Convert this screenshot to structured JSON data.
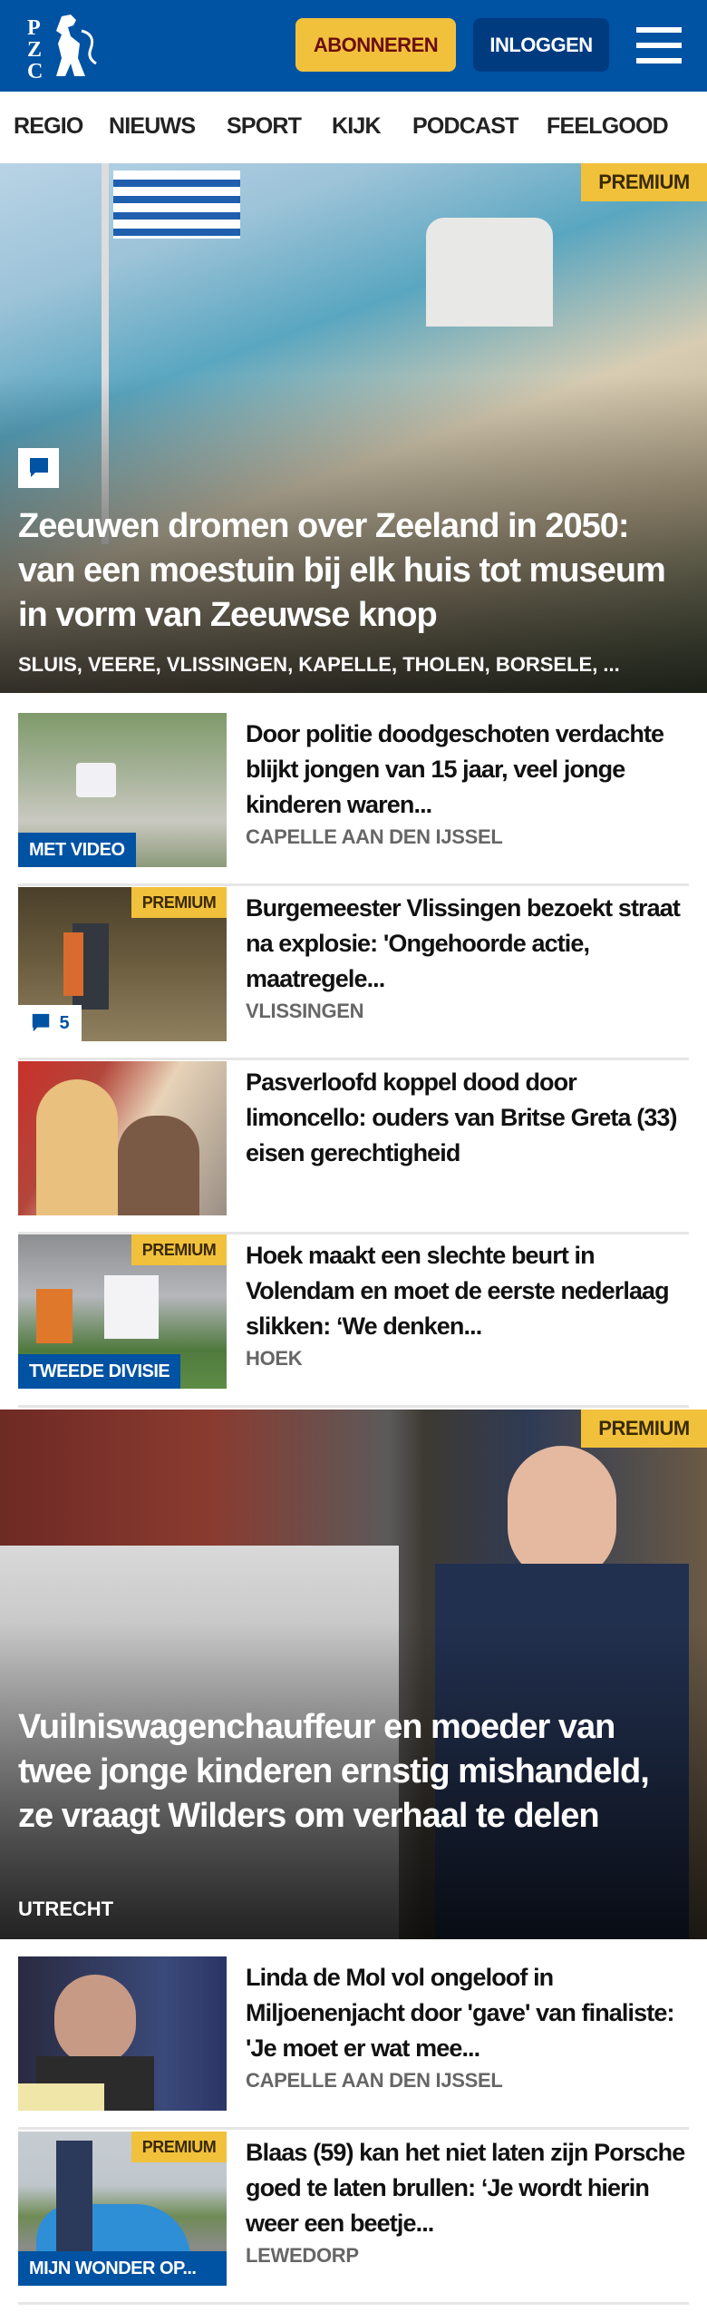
{
  "header": {
    "logo_text": "PZC",
    "subscribe_label": "ABONNEREN",
    "login_label": "INLOGGEN",
    "menu_icon": "hamburger-icon"
  },
  "nav": [
    "REGIO",
    "NIEUWS",
    "SPORT",
    "KIJK",
    "PODCAST",
    "FEELGOOD"
  ],
  "colors": {
    "brand": "#0052a3",
    "premium": "#f2c13c",
    "subscribe_text": "#6b0e0e",
    "login_bg": "#003b80"
  },
  "hero1": {
    "badge": "PREMIUM",
    "headline": "Zeeuwen dromen over Zeeland in 2050: van een moestuin bij elk huis tot museum in vorm van Zeeuwse knop",
    "tags": "SLUIS, VEERE, VLISSINGEN, KAPELLE, THOLEN, BORSELE, ..."
  },
  "list1": [
    {
      "headline": "Door politie doodgeschoten verdachte blijkt jongen van 15 jaar, veel jonge kinderen waren...",
      "location": "CAPELLE AAN DEN IJSSEL",
      "label": "MET VIDEO"
    },
    {
      "headline": "Burgemeester Vlissingen bezoekt straat na explosie: 'Ongehoorde actie, maatregele...",
      "location": "VLISSINGEN",
      "badge": "PREMIUM",
      "comments": "5"
    },
    {
      "headline": "Pasverloofd koppel dood door limoncello: ouders van Britse Greta (33) eisen gerechtigheid"
    },
    {
      "headline": "Hoek maakt een slechte beurt in Volendam en moet de eerste nederlaag slikken: ‘We denken...",
      "location": "HOEK",
      "badge": "PREMIUM",
      "label": "TWEEDE DIVISIE"
    }
  ],
  "hero2": {
    "badge": "PREMIUM",
    "headline": "Vuilniswagenchauffeur en moeder van twee jonge kinderen ernstig mishandeld, ze vraagt Wilders om verhaal te delen",
    "tags": "UTRECHT"
  },
  "list2": [
    {
      "headline": "Linda de Mol vol ongeloof in Miljoenenjacht door 'gave' van finaliste: 'Je moet er wat mee...",
      "location": "CAPELLE AAN DEN IJSSEL"
    },
    {
      "headline": "Blaas (59) kan het niet laten zijn Porsche goed te laten brullen: ‘Je wordt hierin weer een beetje...",
      "location": "LEWEDORP",
      "badge": "PREMIUM",
      "label": "MIJN WONDER OP..."
    }
  ]
}
